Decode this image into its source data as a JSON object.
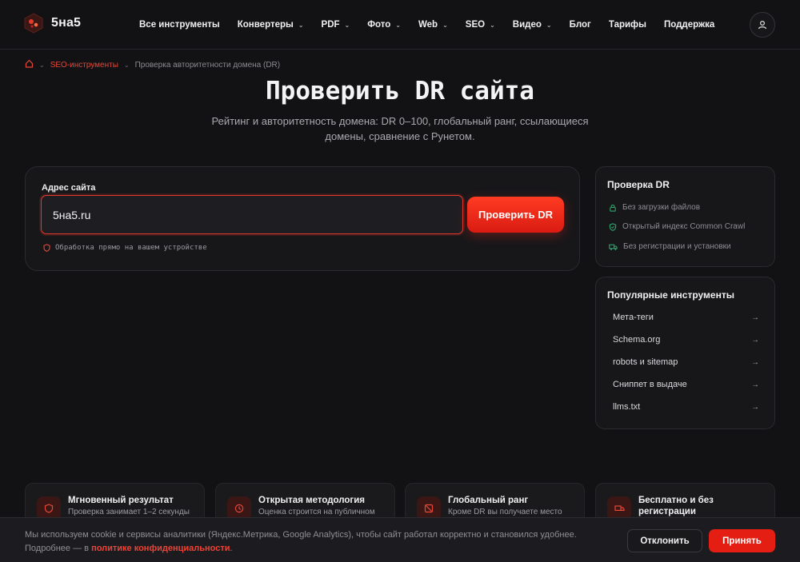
{
  "header": {
    "logo_text": "5на5",
    "nav": [
      {
        "label": "Все инструменты",
        "dropdown": false
      },
      {
        "label": "Конвертеры",
        "dropdown": true
      },
      {
        "label": "PDF",
        "dropdown": true
      },
      {
        "label": "Фото",
        "dropdown": true
      },
      {
        "label": "Web",
        "dropdown": true
      },
      {
        "label": "SEO",
        "dropdown": true
      },
      {
        "label": "Видео",
        "dropdown": true
      },
      {
        "label": "Блог",
        "dropdown": false
      },
      {
        "label": "Тарифы",
        "dropdown": false
      },
      {
        "label": "Поддержка",
        "dropdown": false
      }
    ],
    "user_icon": "user-icon"
  },
  "breadcrumb": {
    "home_icon": "home-icon",
    "section": "SEO-инструменты",
    "current": "Проверка авторитетности домена (DR)"
  },
  "hero": {
    "title": "Проверить DR сайта",
    "subtitle": "Рейтинг и авторитетность домена: DR 0–100, глобальный ранг, ссылающиеся домены, сравнение с Рунетом."
  },
  "form": {
    "label": "Адрес сайта",
    "value": "5на5.ru",
    "button": "Проверить DR",
    "note": "Обработка прямо на вашем устройстве"
  },
  "dr_card": {
    "title": "Проверка DR",
    "features": [
      {
        "icon": "lock-icon",
        "text": "Без загрузки файлов"
      },
      {
        "icon": "shield-icon",
        "text": "Открытый индекс Common Crawl"
      },
      {
        "icon": "truck-icon",
        "text": "Без регистрации и установки"
      }
    ]
  },
  "popular": {
    "title": "Популярные инструменты",
    "items": [
      "Мета-теги",
      "Schema.org",
      "robots и sitemap",
      "Сниппет в выдаче",
      "llms.txt"
    ]
  },
  "features": [
    {
      "icon": "shield-icon",
      "title": "Мгновенный результат",
      "desc": "Проверка занимает 1–2 секунды"
    },
    {
      "icon": "clock-icon",
      "title": "Открытая методология",
      "desc": "Оценка строится на публичном"
    },
    {
      "icon": "no-icon",
      "title": "Глобальный ранг",
      "desc": "Кроме DR вы получаете место"
    },
    {
      "icon": "truck-icon",
      "title": "Бесплатно и без регистрации",
      "desc": ""
    }
  ],
  "cookie": {
    "text": "Мы используем cookie и сервисы аналитики (Яндекс.Метрика, Google Analytics), чтобы сайт работал корректно и становился удобнее. Подробнее — в ",
    "link": "политике конфиденциальности",
    "tail": ".",
    "decline": "Отклонить",
    "accept": "Принять"
  },
  "colors": {
    "accent": "#e5483a",
    "button": "#e41e12",
    "background": "#121214",
    "icon_green": "#2fa36b"
  }
}
